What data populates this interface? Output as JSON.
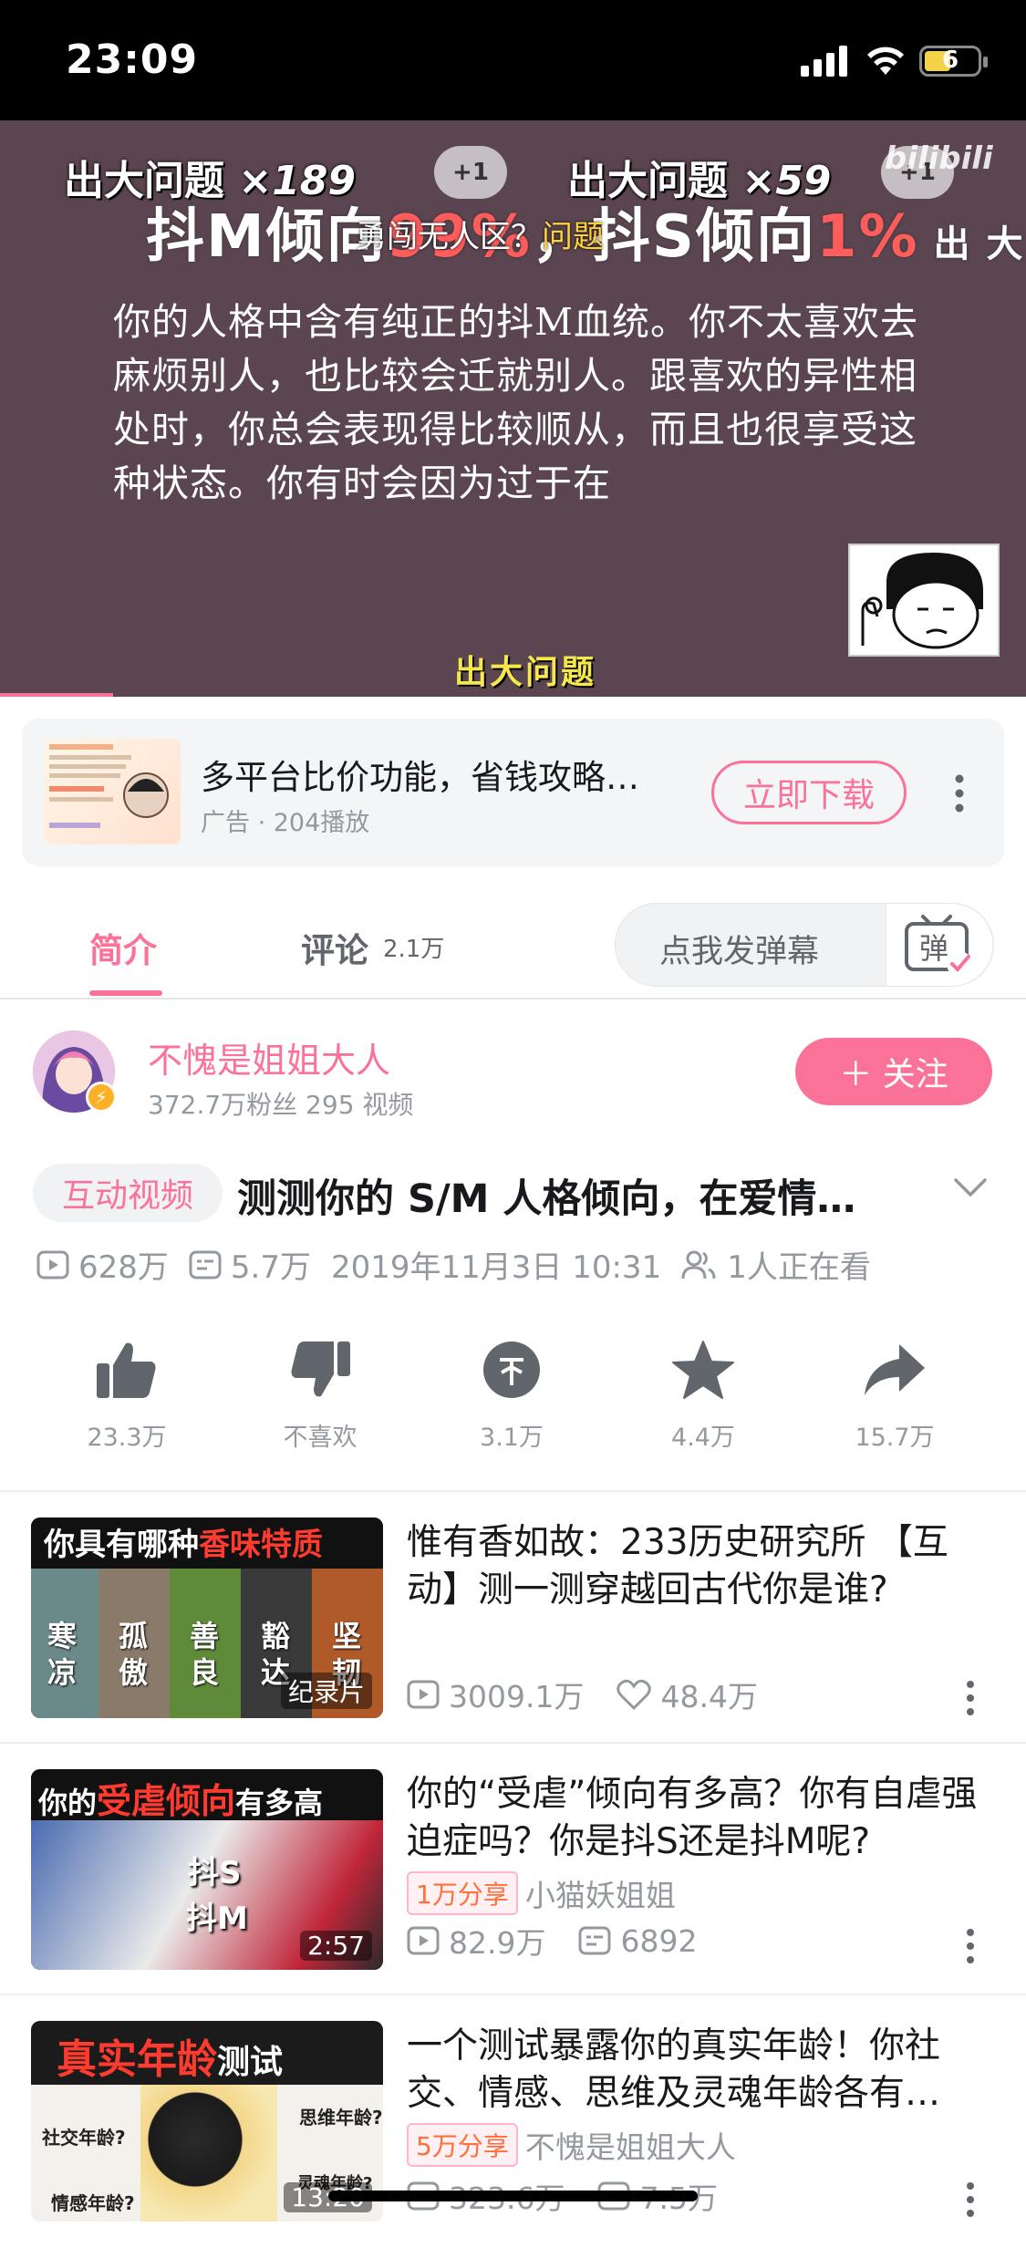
{
  "status_bar": {
    "time": "23:09",
    "battery": "6"
  },
  "video": {
    "danmaku": [
      {
        "text": "出大问题",
        "count": "×189"
      },
      {
        "text": "出大问题",
        "count": "×59"
      }
    ],
    "dm_badge": "+1",
    "overlay_small": "勇闯无人区？",
    "overlay_small_highlight": "问题",
    "title_left": "抖M倾向",
    "title_pct_left": "99%",
    "title_right": "，抖S倾向",
    "title_pct_right": "1%",
    "title_tail": " 出 大 问",
    "description": "你的人格中含有纯正的抖M血统。你不太喜欢去麻烦别人，也比较会迁就别人。跟喜欢的异性相处时，你总会表现得比较顺从，而且也很享受这种状态。你有时会因为过于在",
    "bottom_danmaku": "出大问题",
    "logo": "bilibili",
    "progress": 0.11
  },
  "ad": {
    "title": "多平台比价功能，省钱攻略…",
    "meta": "广告 · 204播放",
    "button": "立即下载"
  },
  "tabs": {
    "intro": "简介",
    "comments": "评论",
    "comments_count": "2.1万",
    "danmaku_placeholder": "点我发弹幕",
    "danmaku_btn": "弹"
  },
  "uploader": {
    "name": "不愧是姐姐大人",
    "meta": "372.7万粉丝  295 视频",
    "follow": "＋ 关注"
  },
  "video_info": {
    "tag": "互动视频",
    "title": "测测你的 S/M 人格倾向，在爱情…",
    "views": "628万",
    "danmaku": "5.7万",
    "date": "2019年11月3日 10:31",
    "watching": "1人正在看"
  },
  "actions": [
    {
      "icon": "like-icon",
      "label": "23.3万"
    },
    {
      "icon": "dislike-icon",
      "label": "不喜欢"
    },
    {
      "icon": "coin-icon",
      "label": "3.1万"
    },
    {
      "icon": "favorite-icon",
      "label": "4.4万"
    },
    {
      "icon": "share-icon",
      "label": "15.7万"
    }
  ],
  "recommendations": [
    {
      "title": "惟有香如故：233历史研究所 【互动】测一测穿越回古代你是谁?",
      "thumb_title_a": "你具有哪种",
      "thumb_title_b": "香味特质",
      "thumb_words": [
        "寒凉",
        "孤傲",
        "善良",
        "豁达",
        "坚韧"
      ],
      "thumb_tag": "纪录片",
      "views": "3009.1万",
      "likes": "48.4万"
    },
    {
      "title": "你的“受虐”倾向有多高？你有自虐强迫症吗？你是抖S还是抖M呢?",
      "thumb_title_a": "你的",
      "thumb_title_b": "受虐倾向",
      "thumb_title_c": "有多高",
      "thumb_label_s": "抖S",
      "thumb_label_m": "抖M",
      "duration": "2:57",
      "share": "1万分享",
      "author": "小猫妖姐姐",
      "views": "82.9万",
      "danmaku": "6892"
    },
    {
      "title": "一个测试暴露你的真实年龄！你社交、情感、思维及灵魂年龄各有…",
      "thumb_title_a": "真实年龄",
      "thumb_title_b": "测试",
      "thumb_labels": [
        "思维年龄?",
        "社交年龄?",
        "情感年龄?",
        "灵魂年龄?"
      ],
      "duration": "13:20",
      "share": "5万分享",
      "author": "不愧是姐姐大人",
      "views": "323.6万",
      "danmaku": "7.5万"
    }
  ],
  "colors": {
    "accent": "#fb7299",
    "grey": "#9499a0"
  }
}
